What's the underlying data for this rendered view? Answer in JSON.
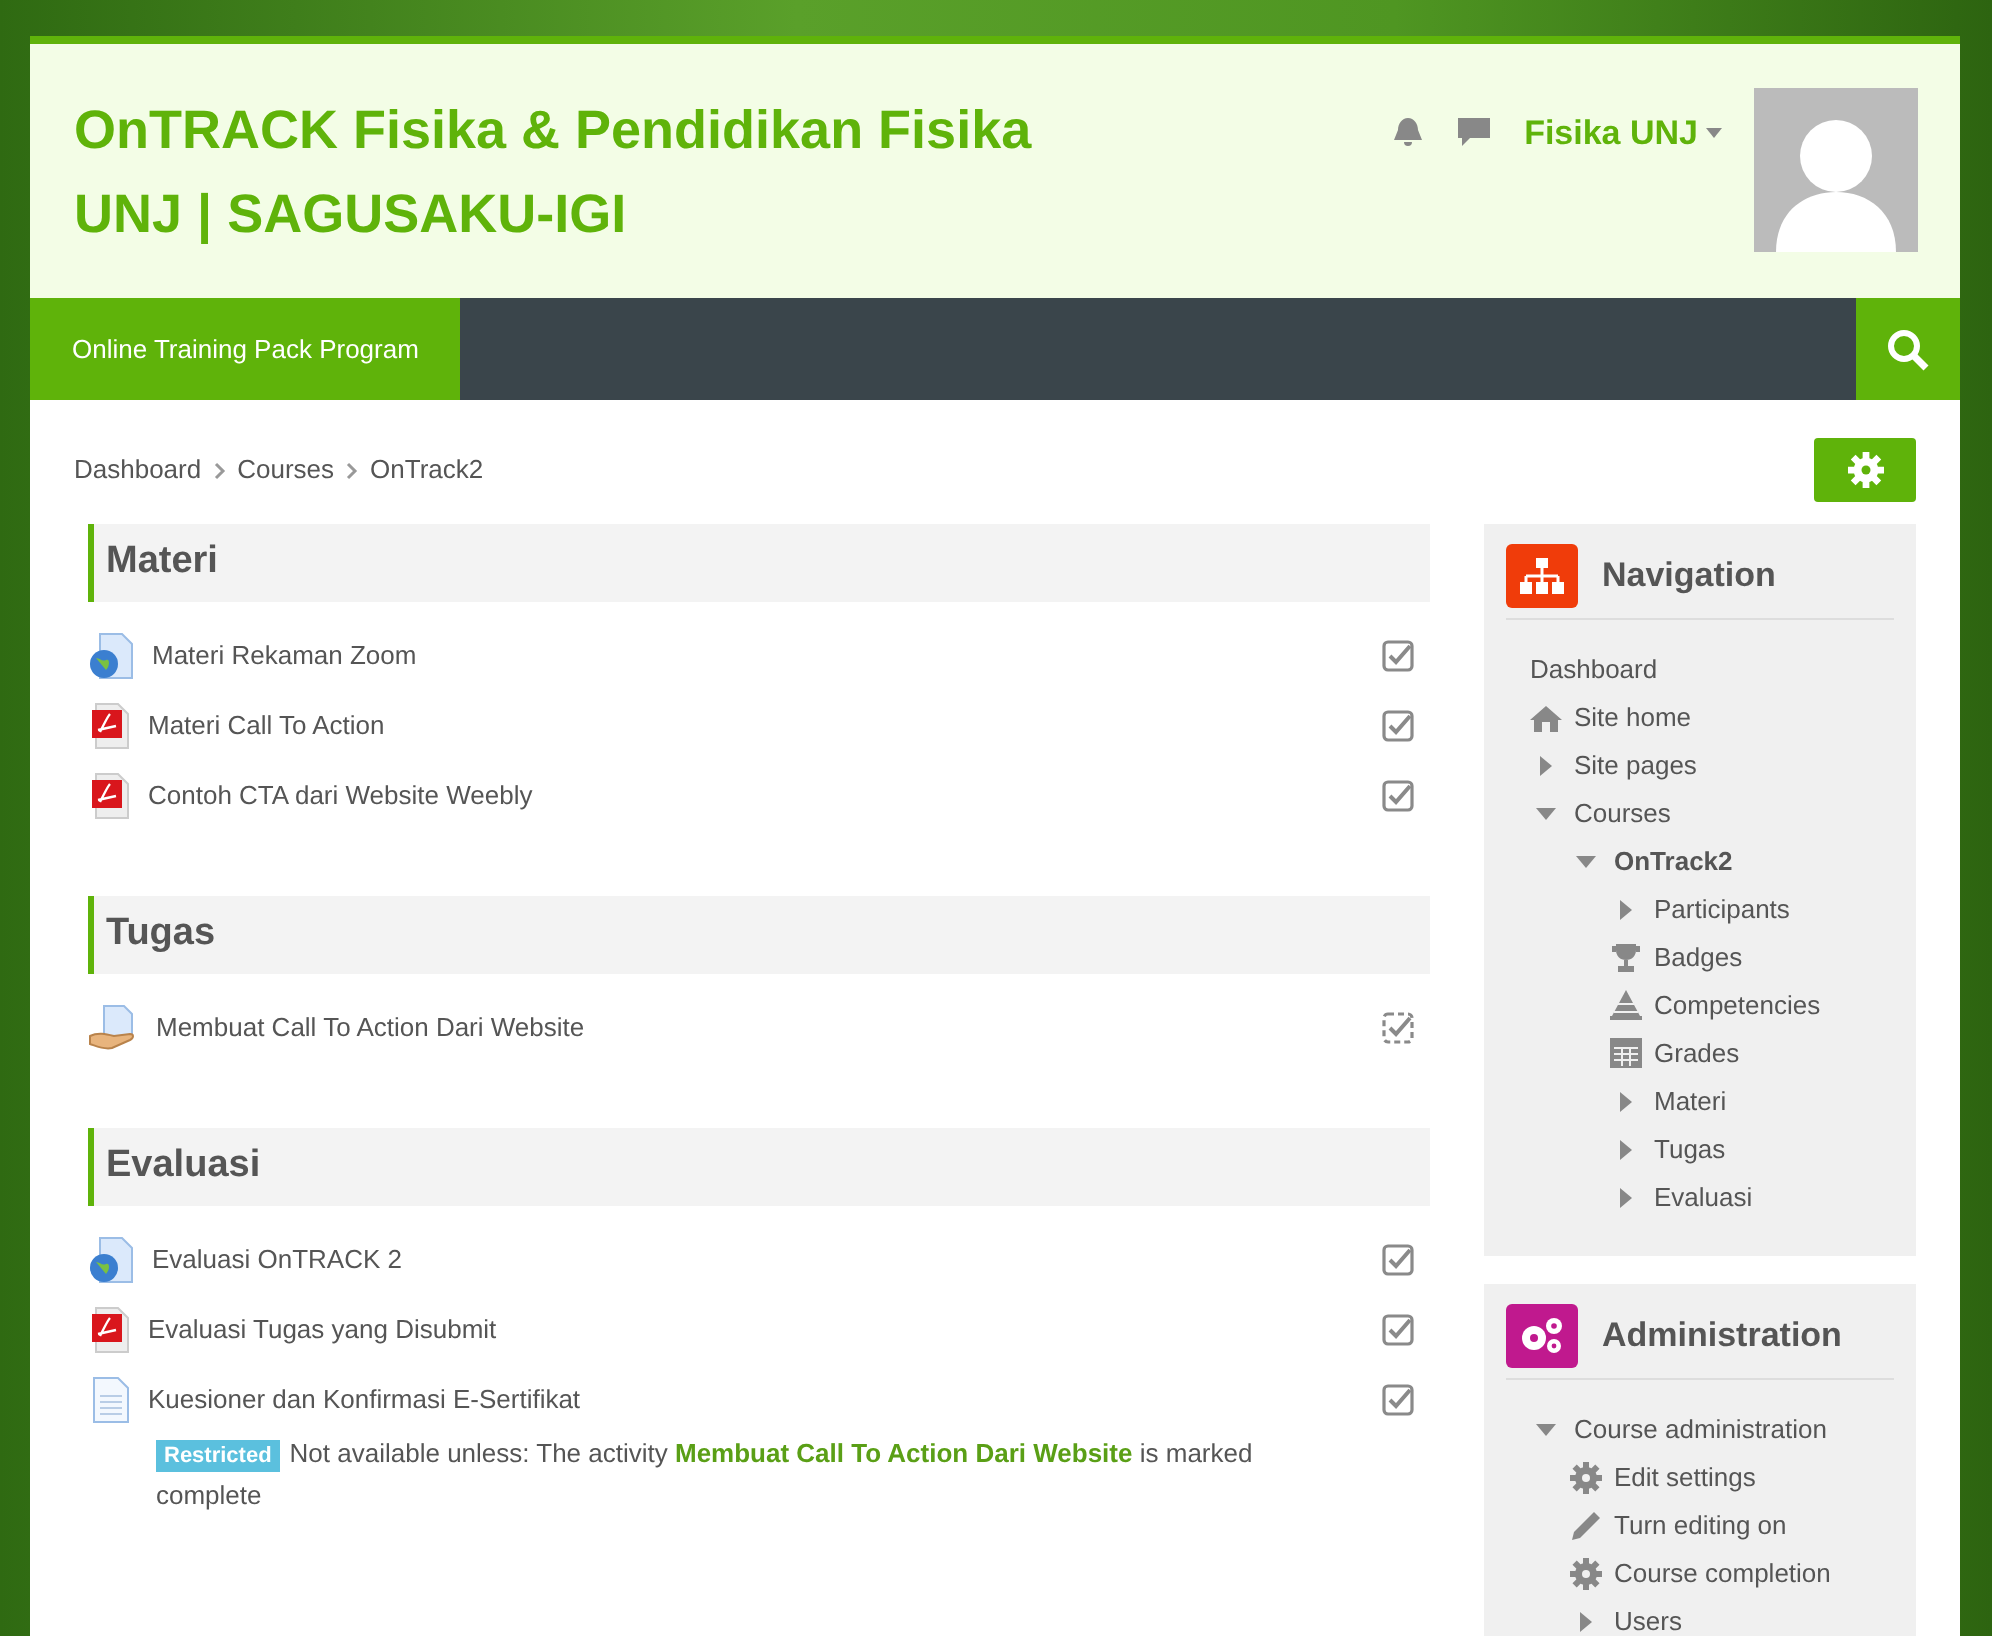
{
  "header": {
    "title": "OnTRACK Fisika & Pendidikan Fisika UNJ | SAGUSAKU-IGI",
    "user_name": "Fisika UNJ"
  },
  "navbar": {
    "items": [
      {
        "label": "Online Training Pack Program",
        "selected": true
      }
    ]
  },
  "breadcrumb": [
    "Dashboard",
    "Courses",
    "OnTrack2"
  ],
  "sections": [
    {
      "title": "Materi",
      "activities": [
        {
          "kind": "url",
          "name": "Materi Rekaman Zoom",
          "auto_completion": false
        },
        {
          "kind": "pdf",
          "name": "Materi Call To Action",
          "auto_completion": false
        },
        {
          "kind": "pdf",
          "name": "Contoh CTA dari Website Weebly",
          "auto_completion": false
        }
      ]
    },
    {
      "title": "Tugas",
      "activities": [
        {
          "kind": "assign",
          "name": "Membuat Call To Action Dari Website",
          "auto_completion": true
        }
      ]
    },
    {
      "title": "Evaluasi",
      "activities": [
        {
          "kind": "url",
          "name": "Evaluasi OnTRACK 2",
          "auto_completion": false
        },
        {
          "kind": "pdf",
          "name": "Evaluasi Tugas yang Disubmit",
          "auto_completion": false
        },
        {
          "kind": "page",
          "name": "Kuesioner dan Konfirmasi E-Sertifikat",
          "auto_completion": false,
          "restriction": {
            "badge": "Restricted",
            "text_before": "Not available unless: The activity",
            "link": "Membuat Call To Action Dari Website",
            "text_after": "is marked complete"
          }
        }
      ]
    }
  ],
  "blocks": [
    {
      "kind": "navigation",
      "title": "Navigation",
      "items": [
        {
          "kind": "plain",
          "label": "Dashboard",
          "current": false
        },
        {
          "kind": "home",
          "label": "Site home",
          "current": false
        },
        {
          "kind": "toggle",
          "label": "Site pages",
          "expanded": false,
          "current": false
        },
        {
          "kind": "toggle",
          "label": "Courses",
          "expanded": true,
          "current": false,
          "children": [
            {
              "kind": "toggle",
              "label": "OnTrack2",
              "expanded": true,
              "current": true,
              "children": [
                {
                  "kind": "toggle",
                  "label": "Participants",
                  "expanded": false,
                  "current": false
                },
                {
                  "kind": "badge",
                  "label": "Badges",
                  "current": false
                },
                {
                  "kind": "competency",
                  "label": "Competencies",
                  "current": false
                },
                {
                  "kind": "grades",
                  "label": "Grades",
                  "current": false
                },
                {
                  "kind": "toggle",
                  "label": "Materi",
                  "expanded": false,
                  "current": false
                },
                {
                  "kind": "toggle",
                  "label": "Tugas",
                  "expanded": false,
                  "current": false
                },
                {
                  "kind": "toggle",
                  "label": "Evaluasi",
                  "expanded": false,
                  "current": false
                }
              ]
            }
          ]
        }
      ]
    },
    {
      "kind": "administration",
      "title": "Administration",
      "items": [
        {
          "kind": "toggle",
          "label": "Course administration",
          "expanded": true,
          "current": false,
          "children": [
            {
              "kind": "gear",
              "label": "Edit settings",
              "current": false
            },
            {
              "kind": "pencil",
              "label": "Turn editing on",
              "current": false
            },
            {
              "kind": "gear",
              "label": "Course completion",
              "current": false
            },
            {
              "kind": "toggle",
              "label": "Users",
              "expanded": false,
              "current": false
            }
          ]
        }
      ]
    }
  ]
}
